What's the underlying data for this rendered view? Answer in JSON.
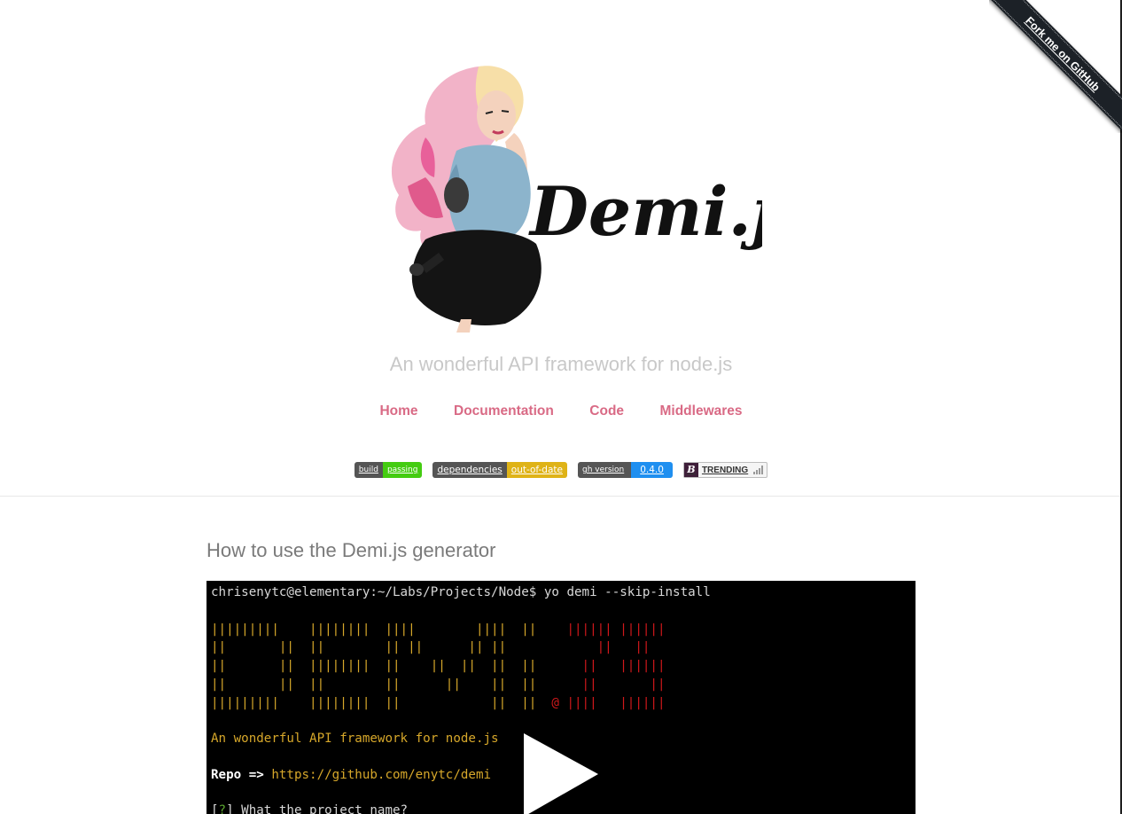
{
  "ribbon": {
    "label": "Fork me on GitHub"
  },
  "hero": {
    "logo_text": "Demi.js",
    "tagline": "An wonderful API framework for node.js"
  },
  "nav": [
    {
      "label": "Home"
    },
    {
      "label": "Documentation"
    },
    {
      "label": "Code"
    },
    {
      "label": "Middlewares"
    }
  ],
  "badges": {
    "build": {
      "left": "build",
      "right": "passing"
    },
    "deps": {
      "left": "dependencies",
      "right": "out-of-date"
    },
    "version": {
      "left": "gh version",
      "right": "0.4.0"
    },
    "trending": {
      "label": "TRENDING"
    }
  },
  "main": {
    "section_title": "How to use the Demi.js generator"
  },
  "terminal": {
    "prompt": "chrisenytc@elementary:~/Labs/Projects/Node$",
    "command": " yo demi --skip-install",
    "art": [
      {
        "yellow": "|||||||||    ||||||||  ||||        ||||  ||",
        "dot": "",
        "red": "    |||||| ||||||"
      },
      {
        "yellow": "||       ||  ||        || ||      || ||",
        "dot": "",
        "red": "            ||   ||"
      },
      {
        "yellow": "||       ||  ||||||||  ||    ||  ||  ||  ||",
        "dot": "",
        "red": "      ||   ||||||"
      },
      {
        "yellow": "||       ||  ||        ||      ||    ||  ||",
        "dot": "",
        "red": "      ||       ||"
      },
      {
        "yellow": "|||||||||    ||||||||  ||            ||  ||",
        "dot": "  @",
        "red": " ||||   ||||||"
      }
    ],
    "tagline": "An wonderful API framework for node.js",
    "repo_label": "Repo =>",
    "repo_url": " https://github.com/enytc/demi",
    "question_open": "[",
    "question_mark": "?",
    "question_text": "] What the project name?"
  },
  "colors": {
    "accent": "#d96a85",
    "terminal_yellow": "#d6a72a",
    "terminal_red": "#d0181b"
  }
}
